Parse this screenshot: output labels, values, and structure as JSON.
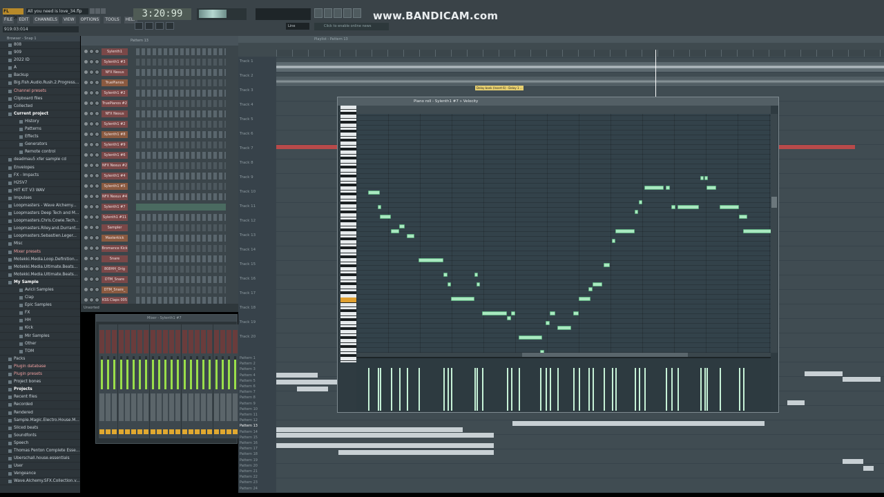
{
  "app": {
    "brand": "FL STUDIO",
    "song_title": "All you need is love_34.flp",
    "time": "3:20:99",
    "hint_text": "919:03:014",
    "line_mode": "Line",
    "news": "Click to enable online news",
    "watermark": "www.BANDICAM.com"
  },
  "menu": [
    "FILE",
    "EDIT",
    "CHANNELS",
    "VIEW",
    "OPTIONS",
    "TOOLS",
    "HELP"
  ],
  "browser": {
    "header": "Browser - Snap 1",
    "items": [
      {
        "label": "808",
        "lvl": 1
      },
      {
        "label": "909",
        "lvl": 1
      },
      {
        "label": "2022 ID",
        "lvl": 1
      },
      {
        "label": "A",
        "lvl": 1
      },
      {
        "label": "Backup",
        "lvl": 1
      },
      {
        "label": "Big.Fish.Audio.Rush.2.Progress...",
        "lvl": 1
      },
      {
        "label": "Channel presets",
        "lvl": 1,
        "hl": true
      },
      {
        "label": "Clipboard files",
        "lvl": 1
      },
      {
        "label": "Collected",
        "lvl": 1
      },
      {
        "label": "Current project",
        "lvl": 1,
        "sel": true
      },
      {
        "label": "History",
        "lvl": 2
      },
      {
        "label": "Patterns",
        "lvl": 2
      },
      {
        "label": "Effects",
        "lvl": 2
      },
      {
        "label": "Generators",
        "lvl": 2
      },
      {
        "label": "Remote control",
        "lvl": 2
      },
      {
        "label": "deadmau5 xfer sample cd",
        "lvl": 1
      },
      {
        "label": "Envelopes",
        "lvl": 1
      },
      {
        "label": "FX - Impacts",
        "lvl": 1
      },
      {
        "label": "H2SV7",
        "lvl": 1
      },
      {
        "label": "HIT KIT V3 WAV",
        "lvl": 1
      },
      {
        "label": "Impulses",
        "lvl": 1
      },
      {
        "label": "Loopmasters - Wave Alchemy...",
        "lvl": 1
      },
      {
        "label": "Loopmasters Deep Tech and M...",
        "lvl": 1
      },
      {
        "label": "Loopmasters.Chris.Cowie.Tech...",
        "lvl": 1
      },
      {
        "label": "Loopmasters.Riley.and.Durrant...",
        "lvl": 1
      },
      {
        "label": "Loopmasters.Sebastien.Leger...",
        "lvl": 1
      },
      {
        "label": "Misc",
        "lvl": 1
      },
      {
        "label": "Mixer presets",
        "lvl": 1,
        "hl": true
      },
      {
        "label": "Motekki.Media.Loop.Definition...",
        "lvl": 1
      },
      {
        "label": "Motekki.Media.Ultimate.Beats...",
        "lvl": 1
      },
      {
        "label": "Motekki.Media.Ultimate.Beats...",
        "lvl": 1
      },
      {
        "label": "My Sample",
        "lvl": 1,
        "sel": true
      },
      {
        "label": "Avicii Samples",
        "lvl": 2
      },
      {
        "label": "Clap",
        "lvl": 2
      },
      {
        "label": "Epic Samples",
        "lvl": 2
      },
      {
        "label": "FX",
        "lvl": 2
      },
      {
        "label": "HH",
        "lvl": 2
      },
      {
        "label": "Kick",
        "lvl": 2
      },
      {
        "label": "Mir Samples",
        "lvl": 2
      },
      {
        "label": "Other",
        "lvl": 2
      },
      {
        "label": "TOM",
        "lvl": 2
      },
      {
        "label": "Packs",
        "lvl": 1
      },
      {
        "label": "Plugin database",
        "lvl": 1,
        "hl": true
      },
      {
        "label": "Plugin presets",
        "lvl": 1,
        "hl": true
      },
      {
        "label": "Project bones",
        "lvl": 1
      },
      {
        "label": "Projects",
        "lvl": 1,
        "sel": true
      },
      {
        "label": "Recent files",
        "lvl": 1
      },
      {
        "label": "Recorded",
        "lvl": 1
      },
      {
        "label": "Rendered",
        "lvl": 1
      },
      {
        "label": "Sample.Magic.Electro.House.M...",
        "lvl": 1
      },
      {
        "label": "Sliced beats",
        "lvl": 1
      },
      {
        "label": "Soundfonts",
        "lvl": 1
      },
      {
        "label": "Speech",
        "lvl": 1
      },
      {
        "label": "Thomas Penton Complete Esse...",
        "lvl": 1
      },
      {
        "label": "Uberschall.house.essentials",
        "lvl": 1
      },
      {
        "label": "User",
        "lvl": 1
      },
      {
        "label": "Vengeance",
        "lvl": 1
      },
      {
        "label": "Wave.Alchemy.SFX.Collection.v...",
        "lvl": 1
      }
    ]
  },
  "rack": {
    "header": "Pattern 13",
    "footer": "Unsorted",
    "channels": [
      "Sylenth1",
      "Sylenth1 #3",
      "NFX Nexus",
      "TruePianos",
      "Sylenth1 #2",
      "TruePianos #2",
      "NFX Nexus",
      "Sylenth1 #2",
      "Sylenth1 #8",
      "Sylenth1 #9",
      "Sylenth1 #6",
      "NFX Nexus #2",
      "Sylenth1 #4",
      "Sylenth1 #5",
      "NFX Nexus #4",
      "Sylenth1 #7",
      "Sylenth1 #11",
      "Sampler",
      "Masterkick",
      "Bromance Kick",
      "Snare",
      "808HH_Orig",
      "DTM_Snare",
      "DTM_Snare_",
      "KSS Claps 005"
    ]
  },
  "mixer": {
    "header": "Mixer - Sylenth1 #7",
    "strips": 22
  },
  "playlist": {
    "header": "Playlist - Pattern 13",
    "tracks": [
      "Track 1",
      "Track 2",
      "Track 3",
      "Track 4",
      "Track 5",
      "Track 6",
      "Track 7",
      "Track 8",
      "Track 9",
      "Track 10",
      "Track 11",
      "Track 12",
      "Track 13",
      "Track 14",
      "Track 15",
      "Track 16",
      "Track 17",
      "Track 18",
      "Track 19",
      "Track 20"
    ],
    "patterns": [
      "Pattern 1",
      "Pattern 2",
      "Pattern 3",
      "Pattern 4",
      "Pattern 5",
      "Pattern 6",
      "Pattern 7",
      "Pattern 8",
      "Pattern 9",
      "Pattern 10",
      "Pattern 11",
      "Pattern 12",
      "Pattern 13",
      "Pattern 14",
      "Pattern 15",
      "Pattern 16",
      "Pattern 17",
      "Pattern 18",
      "Pattern 19",
      "Pattern 20",
      "Pattern 21",
      "Pattern 22",
      "Pattern 23",
      "Pattern 24"
    ],
    "selected_pattern": "Pattern 13",
    "auto_clip": "Delay bank (Insert 6) - Delay 1 ..."
  },
  "pianoroll": {
    "title": "Piano roll - Sylenth1 #7 » Velocity",
    "notes": [
      {
        "s": 0.03,
        "l": 0.03,
        "p": 19
      },
      {
        "s": 0.055,
        "l": 0.008,
        "p": 16
      },
      {
        "s": 0.06,
        "l": 0.03,
        "p": 14
      },
      {
        "s": 0.09,
        "l": 0.02,
        "p": 11
      },
      {
        "s": 0.11,
        "l": 0.015,
        "p": 12
      },
      {
        "s": 0.13,
        "l": 0.02,
        "p": 10
      },
      {
        "s": 0.16,
        "l": 0.065,
        "p": 5
      },
      {
        "s": 0.225,
        "l": 0.01,
        "p": 2
      },
      {
        "s": 0.235,
        "l": 0.01,
        "p": 0
      },
      {
        "s": 0.245,
        "l": 0.06,
        "p": -3
      },
      {
        "s": 0.305,
        "l": 0.01,
        "p": 2
      },
      {
        "s": 0.31,
        "l": 0.01,
        "p": 0
      },
      {
        "s": 0.325,
        "l": 0.065,
        "p": -6
      },
      {
        "s": 0.39,
        "l": 0.01,
        "p": -7
      },
      {
        "s": 0.4,
        "l": 0.01,
        "p": -6
      },
      {
        "s": 0.42,
        "l": 0.06,
        "p": -11
      },
      {
        "s": 0.475,
        "l": 0.01,
        "p": -14
      },
      {
        "s": 0.49,
        "l": 0.01,
        "p": -8
      },
      {
        "s": 0.5,
        "l": 0.015,
        "p": -6
      },
      {
        "s": 0.52,
        "l": 0.035,
        "p": -9
      },
      {
        "s": 0.56,
        "l": 0.015,
        "p": -6
      },
      {
        "s": 0.575,
        "l": 0.03,
        "p": -3
      },
      {
        "s": 0.6,
        "l": 0.01,
        "p": -1
      },
      {
        "s": 0.61,
        "l": 0.025,
        "p": 0
      },
      {
        "s": 0.64,
        "l": 0.015,
        "p": 4
      },
      {
        "s": 0.66,
        "l": 0.01,
        "p": 9
      },
      {
        "s": 0.67,
        "l": 0.05,
        "p": 11
      },
      {
        "s": 0.72,
        "l": 0.008,
        "p": 15
      },
      {
        "s": 0.73,
        "l": 0.008,
        "p": 17
      },
      {
        "s": 0.745,
        "l": 0.05,
        "p": 20
      },
      {
        "s": 0.8,
        "l": 0.01,
        "p": 20
      },
      {
        "s": 0.815,
        "l": 0.01,
        "p": 16
      },
      {
        "s": 0.83,
        "l": 0.055,
        "p": 16
      },
      {
        "s": 0.89,
        "l": 0.008,
        "p": 22
      },
      {
        "s": 0.9,
        "l": 0.008,
        "p": 22
      },
      {
        "s": 0.905,
        "l": 0.025,
        "p": 20
      },
      {
        "s": 0.94,
        "l": 0.05,
        "p": 16
      },
      {
        "s": 0.99,
        "l": 0.02,
        "p": 14
      },
      {
        "s": 1.0,
        "l": 0.08,
        "p": 11
      }
    ]
  }
}
